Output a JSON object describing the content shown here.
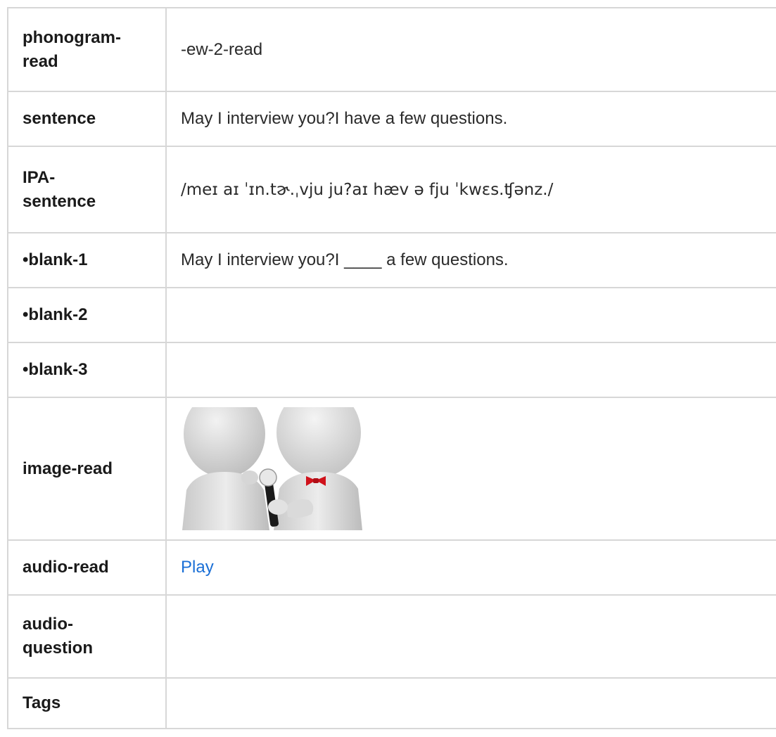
{
  "rows": [
    {
      "label": "phonogram-\nread",
      "value": "-ew-2-read"
    },
    {
      "label": "sentence",
      "value": "May I interview you?I have a few questions."
    },
    {
      "label": "IPA-\nsentence",
      "value": "/meɪ aɪ ˈɪn.tɚ.ˌvju ju?aɪ hæv ə fju ˈkwɛs.ʧənz./"
    },
    {
      "label": "•blank-1",
      "value": "May I interview you?I ____ a few questions."
    },
    {
      "label": "•blank-2",
      "value": ""
    },
    {
      "label": "•blank-3",
      "value": ""
    },
    {
      "label": "image-read",
      "image": "interview-illustration"
    },
    {
      "label": "audio-read",
      "link": "Play"
    },
    {
      "label": "audio-\nquestion",
      "value": ""
    },
    {
      "label": "Tags",
      "value": ""
    }
  ],
  "colors": {
    "border": "#d7d7d7",
    "link": "#1a6fd6",
    "bowtie": "#d0121b"
  }
}
